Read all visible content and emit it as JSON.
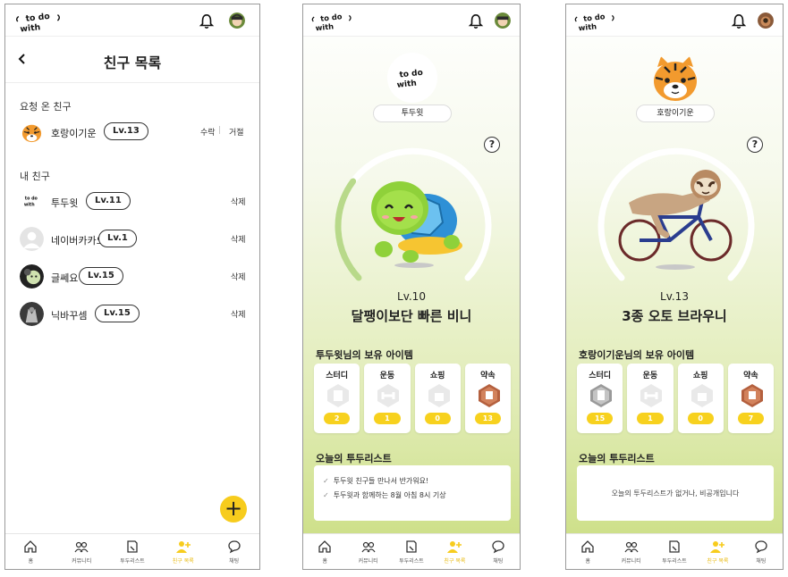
{
  "logo_text": [
    "to do",
    "with"
  ],
  "bottom_nav": [
    {
      "label": "홈",
      "icon": "home-icon"
    },
    {
      "label": "커뮤니티",
      "icon": "community-icon"
    },
    {
      "label": "투두리스트",
      "icon": "todolist-icon"
    },
    {
      "label": "친구 목록",
      "icon": "add-friend-icon",
      "active": true
    },
    {
      "label": "채팅",
      "icon": "chat-icon"
    }
  ],
  "friends_screen": {
    "title": "친구 목록",
    "requests_label": "요청 온 친구",
    "requests": [
      {
        "name": "호랑이기운",
        "level": "Lv.13",
        "accept": "수락",
        "reject": "거절"
      }
    ],
    "my_friends_label": "내 친구",
    "friends": [
      {
        "name": "투두윗",
        "level": "Lv.11",
        "action": "삭제"
      },
      {
        "name": "네이버카카오",
        "level": "Lv.1",
        "action": "삭제"
      },
      {
        "name": "글쎄요",
        "level": "Lv.15",
        "action": "삭제"
      },
      {
        "name": "닉바꾸셈",
        "level": "Lv.15",
        "action": "삭제"
      }
    ],
    "fab": "+"
  },
  "profile_todowith": {
    "username": "투두윗",
    "level": "Lv.10",
    "level_progress": 0.3,
    "character_name": "달팽이보단 빠른 비니",
    "items_title": "투두윗님의 보유 아이템",
    "items": [
      {
        "name": "스터디",
        "count": "2",
        "badge": "gray"
      },
      {
        "name": "운동",
        "count": "1",
        "badge": "gray"
      },
      {
        "name": "쇼핑",
        "count": "0",
        "badge": "gray"
      },
      {
        "name": "약속",
        "count": "13",
        "badge": "bronze"
      }
    ],
    "todo_title": "오늘의 투두리스트",
    "todos": [
      "투두윗 친구들 만나서 반가워요!",
      "투두윗과 함께하는 8월 아침 8시 기상"
    ],
    "help": "?"
  },
  "profile_tiger": {
    "username": "호랑이기운",
    "level": "Lv.13",
    "level_progress": 0.0,
    "character_name": "3종 오토 브라우니",
    "items_title": "호랑이기운님의 보유 아이템",
    "items": [
      {
        "name": "스터디",
        "count": "15",
        "badge": "silver"
      },
      {
        "name": "운동",
        "count": "1",
        "badge": "gray"
      },
      {
        "name": "쇼핑",
        "count": "0",
        "badge": "gray"
      },
      {
        "name": "약속",
        "count": "7",
        "badge": "bronze"
      }
    ],
    "todo_title": "오늘의 투두리스트",
    "todo_empty": "오늘의 투두리스트가 없거나, 비공개입니다",
    "help": "?"
  },
  "colors": {
    "accent": "#f7cc1d",
    "green_bg": "#c9dd7f",
    "gauge_track": "#ffffff",
    "gauge_fill": "#b8d98a"
  }
}
